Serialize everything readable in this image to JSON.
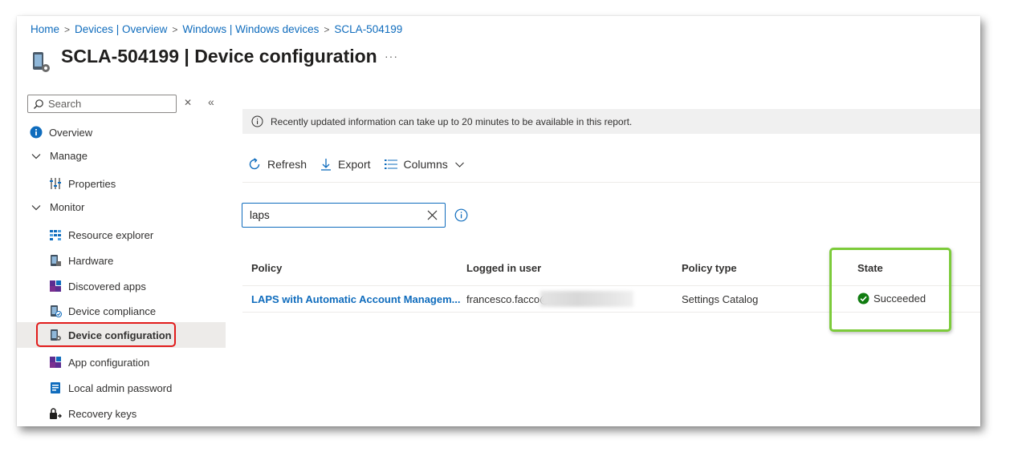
{
  "breadcrumb": [
    "Home",
    "Devices | Overview",
    "Windows | Windows devices",
    "SCLA-504199"
  ],
  "title": {
    "device": "SCLA-504199",
    "section": " | Device configuration",
    "more": "···"
  },
  "sidebar": {
    "search_placeholder": "Search",
    "items": [
      {
        "label": "Overview",
        "icon": "info-icon"
      },
      {
        "label": "Manage",
        "icon": "chevron-down-icon"
      },
      {
        "label": "Properties",
        "icon": "properties-icon"
      },
      {
        "label": "Monitor",
        "icon": "chevron-down-icon"
      },
      {
        "label": "Resource explorer",
        "icon": "resource-explorer-icon"
      },
      {
        "label": "Hardware",
        "icon": "hardware-icon"
      },
      {
        "label": "Discovered apps",
        "icon": "apps-icon"
      },
      {
        "label": "Device compliance",
        "icon": "compliance-icon"
      },
      {
        "label": "Device configuration",
        "icon": "device-config-icon"
      },
      {
        "label": "App configuration",
        "icon": "app-config-icon"
      },
      {
        "label": "Local admin password",
        "icon": "local-admin-icon"
      },
      {
        "label": "Recovery keys",
        "icon": "recovery-keys-icon"
      }
    ],
    "selected": "Device configuration"
  },
  "info_bar": {
    "text": "Recently updated information can take up to 20 minutes to be available in this report."
  },
  "toolbar": {
    "refresh": "Refresh",
    "export": "Export",
    "columns": "Columns"
  },
  "filter": {
    "value": "laps"
  },
  "table": {
    "headers": [
      "Policy",
      "Logged in user",
      "Policy type",
      "State"
    ],
    "rows": [
      {
        "policy": "LAPS with Automatic Account Managem...",
        "user": "francesco.facco@s",
        "policy_type": "Settings Catalog",
        "state": "Succeeded"
      }
    ]
  },
  "colors": {
    "link": "#0f6cbd",
    "success": "#107c10",
    "highlight_red": "#e11b1b",
    "highlight_green": "#7ccb3a"
  }
}
